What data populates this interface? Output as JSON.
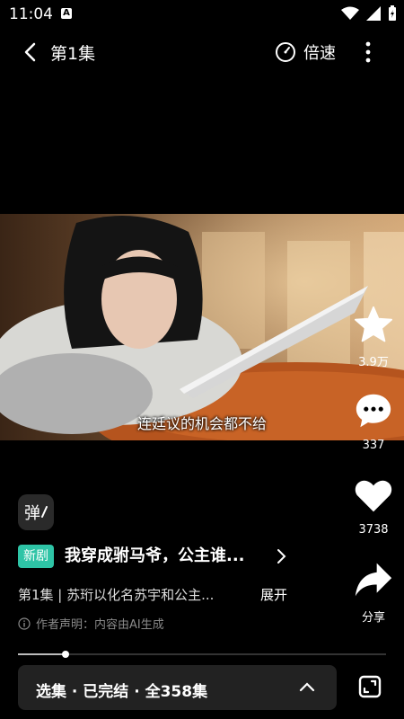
{
  "status_bar": {
    "time": "11:04",
    "badge": "A"
  },
  "header": {
    "title": "第1集",
    "speed_label": "倍速"
  },
  "video": {
    "subtitle": "连廷议的机会都不给"
  },
  "actions": {
    "favorite_count": "3.9万",
    "comment_count": "337",
    "like_count": "3738",
    "share_label": "分享"
  },
  "info": {
    "danmu_label": "弹",
    "new_tag": "新剧",
    "drama_title": "我穿成驸马爷，公主谁...",
    "description": "第1集 | 苏珩以化名苏宇和公主...",
    "expand_label": "展开",
    "declaration": "作者声明：内容由AI生成"
  },
  "playback": {
    "progress": 0.13
  },
  "episodes": {
    "label": "选集 · 已完结 · 全358集"
  },
  "colors": {
    "accent": "#2ec4a6",
    "background": "#000000",
    "panel": "#222222"
  }
}
